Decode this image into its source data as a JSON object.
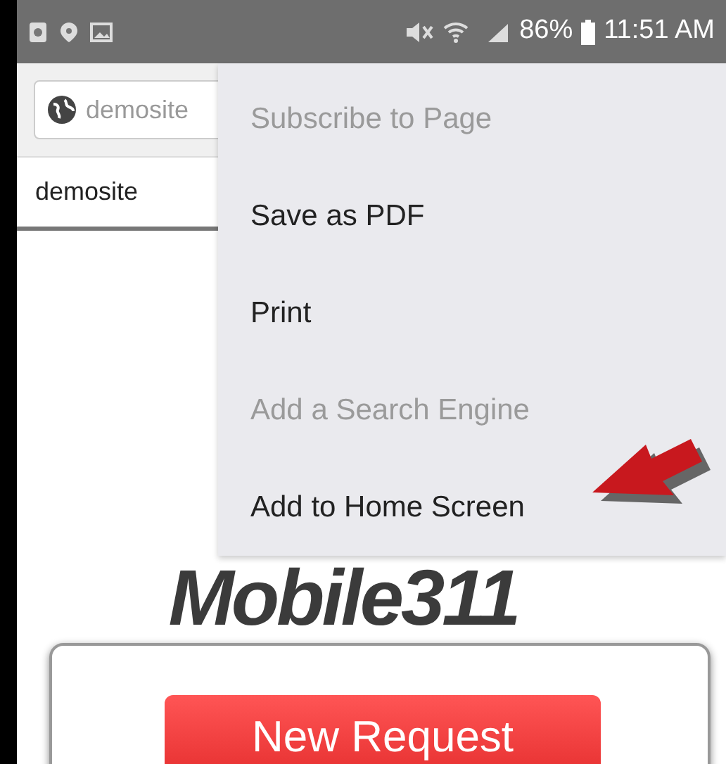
{
  "status_bar": {
    "battery": "86%",
    "time": "11:51 AM"
  },
  "address_bar": {
    "value": "demosite"
  },
  "tabs": [
    {
      "label": "demosite",
      "selected": true
    }
  ],
  "page": {
    "logo": "Mobile311",
    "button": "New Request"
  },
  "menu": {
    "items": [
      {
        "label": "Subscribe to Page",
        "disabled": true
      },
      {
        "label": "Save as PDF",
        "disabled": false
      },
      {
        "label": "Print",
        "disabled": false
      },
      {
        "label": "Add a Search Engine",
        "disabled": true
      },
      {
        "label": "Add to Home Screen",
        "disabled": false
      }
    ]
  }
}
